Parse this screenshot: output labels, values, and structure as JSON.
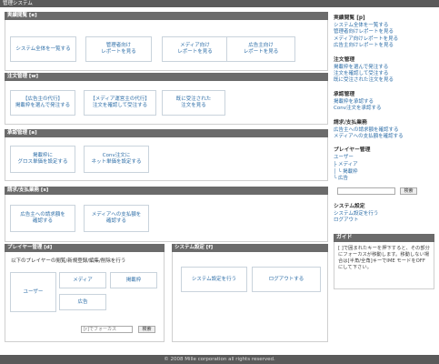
{
  "app_title": "管理システム",
  "sections": {
    "jisseki": {
      "title": "実績閲覧 [e]",
      "tiles": [
        "システム全体を一覧する",
        "管理者向け\nレポートを見る",
        "メディア向け\nレポートを見る",
        "広告主向け\nレポートを見る"
      ]
    },
    "chumon": {
      "title": "注文管理 [w]",
      "tiles": [
        "【広告主の代行】\n掲載枠を選んで発注する",
        "【メディア運営主の代行】\n注文を確認して受注する",
        "既に受注された\n注文を見る"
      ]
    },
    "shonin": {
      "title": "承認管理 [a]",
      "tiles": [
        "掲載枠に\nグロス単価を設定する",
        "Conv注文に\nネット単価を設定する"
      ]
    },
    "seikyu": {
      "title": "請求/支払業務 [s]",
      "tiles": [
        "広告主への請求額を\n確認する",
        "メディアへの支払額を\n確認する"
      ]
    },
    "player": {
      "title": "プレイヤー管理 [d]",
      "note": "以下のプレイヤーの閲覧/新規登録/編集/削除を行う",
      "user": "ユーザー",
      "media": "メディア",
      "slot": "掲載枠",
      "advertiser": "広告",
      "focus_placeholder": "[r]でフォーカス",
      "search_label": "検索"
    },
    "system": {
      "title": "システム設定 [f]",
      "settings": "システム設定を行う",
      "logout": "ログアウトする"
    }
  },
  "sidebar": {
    "jisseki_title": "実績閲覧 [p]",
    "jisseki_links": [
      "システム全体を一覧する",
      "管理者向けレポートを見る",
      "メディア向けレポートを見る",
      "広告主向けレポートを見る"
    ],
    "chumon_title": "注文管理",
    "chumon_links": [
      "掲載枠を選んで発注する",
      "注文を確認して受注する",
      "既に受注された注文を見る"
    ],
    "shonin_title": "承認管理",
    "shonin_links": [
      "掲載枠を承認する",
      "Conv注文を承認する"
    ],
    "seikyu_title": "請求/支払業務",
    "seikyu_links": [
      "広告主への請求額を確認する",
      "メディアへの支払額を確認する"
    ],
    "player_title": "プレイヤー管理",
    "player_tree": [
      "ユーザー",
      "├ メディア",
      "│ └ 掲載枠",
      "└ 広告"
    ],
    "search_label": "検索",
    "system_title": "システム設定",
    "system_links": [
      "システム設定を行う",
      "ログアウト"
    ],
    "guide_title": "ガイド",
    "guide_text": "[ ]で囲まれたキーを押下すると、その部分にフォーカスが移動します。移動しない場合は[半角/全角]キーでIME モードをOFFにして下さい。"
  },
  "footer": "© 2008 Mille corporation all rights reserved."
}
